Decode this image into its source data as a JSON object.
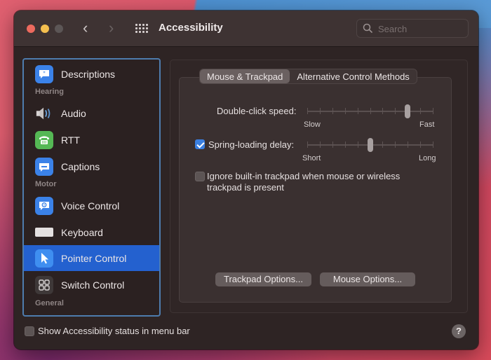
{
  "window": {
    "title": "Accessibility",
    "nav": {
      "back": "‹",
      "forward": "›"
    },
    "search": {
      "placeholder": "Search",
      "value": ""
    }
  },
  "sidebar": {
    "items": [
      {
        "type": "item",
        "label": "Descriptions",
        "icon": "descriptions-icon",
        "selected": false
      },
      {
        "type": "section",
        "label": "Hearing"
      },
      {
        "type": "item",
        "label": "Audio",
        "icon": "speaker-icon",
        "selected": false
      },
      {
        "type": "item",
        "label": "RTT",
        "icon": "telephone-icon",
        "selected": false
      },
      {
        "type": "item",
        "label": "Captions",
        "icon": "captions-icon",
        "selected": false
      },
      {
        "type": "section",
        "label": "Motor"
      },
      {
        "type": "item",
        "label": "Voice Control",
        "icon": "voice-control-icon",
        "selected": false
      },
      {
        "type": "item",
        "label": "Keyboard",
        "icon": "keyboard-icon",
        "selected": false
      },
      {
        "type": "item",
        "label": "Pointer Control",
        "icon": "pointer-icon",
        "selected": true
      },
      {
        "type": "item",
        "label": "Switch Control",
        "icon": "switch-control-icon",
        "selected": false
      },
      {
        "type": "section",
        "label": "General"
      }
    ]
  },
  "main": {
    "tabs": [
      {
        "label": "Mouse & Trackpad",
        "active": true
      },
      {
        "label": "Alternative Control Methods",
        "active": false
      }
    ],
    "double_click": {
      "label": "Double-click speed:",
      "min_label": "Slow",
      "max_label": "Fast",
      "ticks": 11,
      "value_index": 8
    },
    "spring_loading": {
      "label": "Spring-loading delay:",
      "checked": true,
      "min_label": "Short",
      "max_label": "Long",
      "ticks": 11,
      "value_index": 5
    },
    "ignore_trackpad": {
      "label_line1": "Ignore built-in trackpad when mouse or wireless",
      "label_line2": "trackpad is present",
      "checked": false
    },
    "buttons": {
      "trackpad_options": "Trackpad Options...",
      "mouse_options": "Mouse Options..."
    }
  },
  "footer": {
    "show_status_label": "Show Accessibility status in menu bar",
    "show_status_checked": false,
    "help": "?"
  },
  "colors": {
    "selection": "#2461cf",
    "sidebar_focus_ring": "#4e7cae",
    "checkbox_accent": "#3a7fe0"
  }
}
